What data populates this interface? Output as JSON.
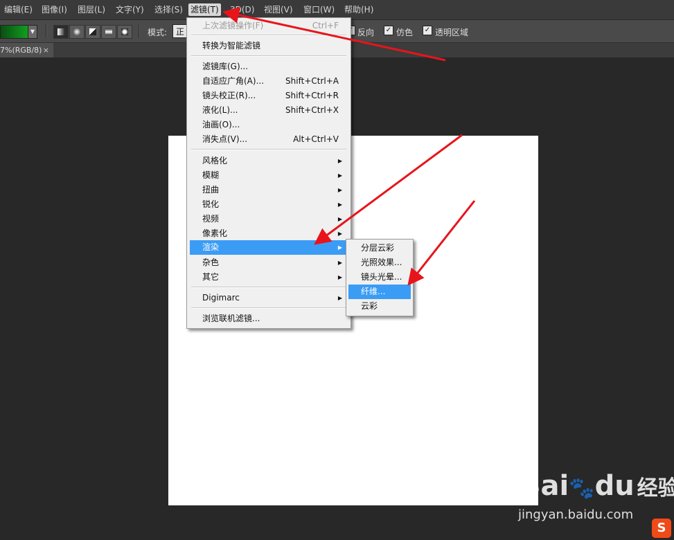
{
  "menubar": {
    "items": [
      {
        "label": "编辑(E)"
      },
      {
        "label": "图像(I)"
      },
      {
        "label": "图层(L)"
      },
      {
        "label": "文字(Y)"
      },
      {
        "label": "选择(S)"
      },
      {
        "label": "滤镜(T)"
      },
      {
        "label": "3D(D)"
      },
      {
        "label": "视图(V)"
      },
      {
        "label": "窗口(W)"
      },
      {
        "label": "帮助(H)"
      }
    ]
  },
  "options": {
    "mode_label": "模式:",
    "mode_value": "正",
    "reverse_label": "反向",
    "dither_label": "仿色",
    "transparency_label": "透明区域"
  },
  "document_tab": {
    "title": "7%(RGB/8)",
    "close": "×"
  },
  "filter_menu": {
    "items": [
      {
        "label": "上次滤镜操作(F)",
        "shortcut": "Ctrl+F"
      },
      {
        "label": "转换为智能滤镜",
        "shortcut": ""
      },
      {
        "label": "滤镜库(G)...",
        "shortcut": ""
      },
      {
        "label": "自适应广角(A)...",
        "shortcut": "Shift+Ctrl+A"
      },
      {
        "label": "镜头校正(R)...",
        "shortcut": "Shift+Ctrl+R"
      },
      {
        "label": "液化(L)...",
        "shortcut": "Shift+Ctrl+X"
      },
      {
        "label": "油画(O)...",
        "shortcut": ""
      },
      {
        "label": "消失点(V)...",
        "shortcut": "Alt+Ctrl+V"
      },
      {
        "label": "风格化"
      },
      {
        "label": "模糊"
      },
      {
        "label": "扭曲"
      },
      {
        "label": "锐化"
      },
      {
        "label": "视频"
      },
      {
        "label": "像素化"
      },
      {
        "label": "渲染"
      },
      {
        "label": "杂色"
      },
      {
        "label": "其它"
      },
      {
        "label": "Digimarc"
      },
      {
        "label": "浏览联机滤镜..."
      }
    ]
  },
  "render_submenu": {
    "items": [
      {
        "label": "分层云彩"
      },
      {
        "label": "光照效果..."
      },
      {
        "label": "镜头光晕..."
      },
      {
        "label": "纤维..."
      },
      {
        "label": "云彩"
      }
    ]
  },
  "watermark": {
    "brand_a": "Bai",
    "brand_b": "du",
    "brand_c": "经验",
    "url": "jingyan.baidu.com",
    "sogou": "S"
  },
  "colors": {
    "highlight": "#3b9cf5",
    "arrow": "#e8141b",
    "canvas": "#ffffff",
    "workspace": "#282828"
  }
}
